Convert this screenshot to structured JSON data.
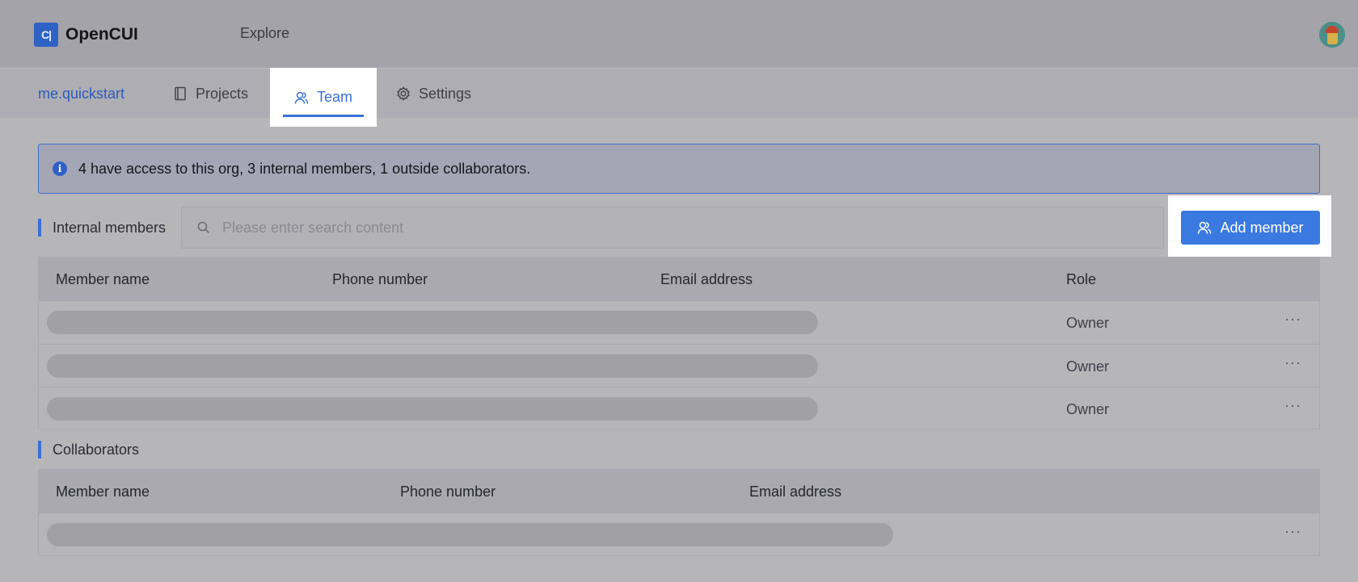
{
  "app": {
    "logo_glyph": "C|",
    "name": "OpenCUI",
    "explore_label": "Explore"
  },
  "subnav": {
    "org": "me.quickstart",
    "tabs": [
      {
        "label": "Projects",
        "icon": "book-icon"
      },
      {
        "label": "Team",
        "icon": "team-icon",
        "active": true
      },
      {
        "label": "Settings",
        "icon": "gear-icon"
      }
    ]
  },
  "info": {
    "icon": "i",
    "text": "4 have access to this org, 3 internal members, 1 outside collaborators."
  },
  "internal": {
    "title": "Internal members",
    "search_placeholder": "Please enter search content",
    "add_label": "Add member",
    "columns": [
      "Member name",
      "Phone number",
      "Email address",
      "Role"
    ],
    "rows": [
      {
        "role": "Owner",
        "more": "···"
      },
      {
        "role": "Owner",
        "more": "···"
      },
      {
        "role": "Owner",
        "more": "···"
      }
    ]
  },
  "collaborators": {
    "title": "Collaborators",
    "columns": [
      "Member name",
      "Phone number",
      "Email address"
    ],
    "rows": [
      {
        "more": "···"
      }
    ]
  },
  "colors": {
    "accent": "#3a7ae0",
    "brand": "#2f62c5",
    "overlay": "#b6b6b9"
  }
}
